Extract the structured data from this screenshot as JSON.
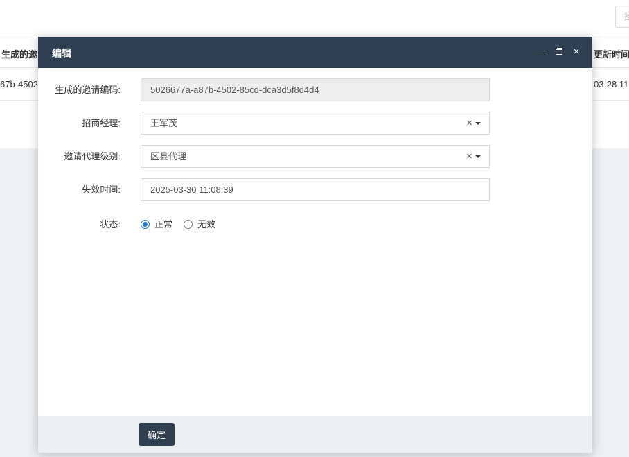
{
  "background": {
    "search_placeholder": "搜",
    "table_header_left": "生成的邀",
    "table_header_right": "更新时间",
    "row_cell_left": "67b-4502",
    "row_cell_right": "03-28 11"
  },
  "modal": {
    "title": "编辑",
    "close_glyph": "×",
    "fields": {
      "invite_code": {
        "label": "生成的邀请编码:",
        "value": "5026677a-a87b-4502-85cd-dca3d5f8d4d4"
      },
      "manager": {
        "label": "招商经理:",
        "value": "王军茂",
        "clear_glyph": "×"
      },
      "agent_level": {
        "label": "邀请代理级别:",
        "value": "区县代理",
        "clear_glyph": "×"
      },
      "expire_time": {
        "label": "失效时间:",
        "value": "2025-03-30 11:08:39"
      },
      "status": {
        "label": "状态:",
        "options": [
          {
            "label": "正常",
            "checked": true
          },
          {
            "label": "无效",
            "checked": false
          }
        ]
      }
    },
    "confirm_label": "确定"
  },
  "colors": {
    "header_bg": "#2f3e51",
    "accent": "#1e73d6",
    "footer_bg": "#edf0f2"
  }
}
